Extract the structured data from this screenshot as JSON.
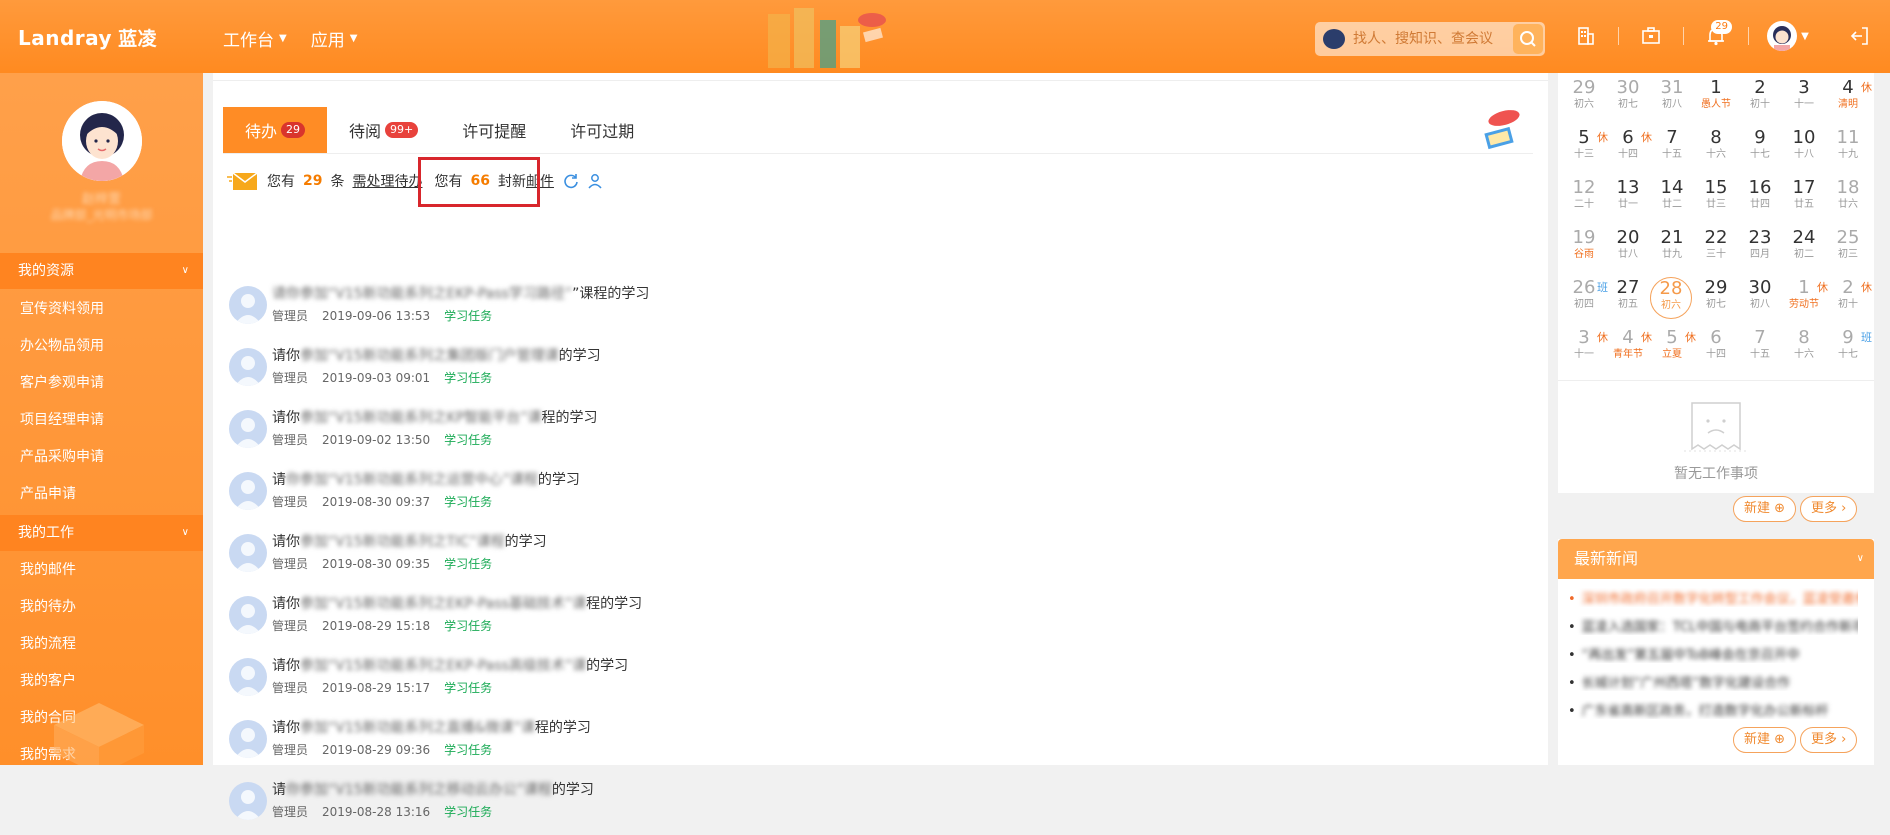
{
  "header": {
    "logo_en": "Landray",
    "logo_cn": "蓝凌",
    "nav": [
      {
        "label": "工作台"
      },
      {
        "label": "应用"
      }
    ],
    "search_placeholder": "找人、搜知识、查会议",
    "notification_count": "29",
    "colors": {
      "brand": "#ff8a20",
      "accent": "#f57c00"
    }
  },
  "sidebar": {
    "user_name": "赵梓萱",
    "user_dept": "品牌部_光明市场部",
    "sections": [
      {
        "label": "我的资源",
        "items": [
          "宣传资料领用",
          "办公物品领用",
          "客户参观申请",
          "项目经理申请",
          "产品采购申请",
          "产品申请"
        ]
      },
      {
        "label": "我的工作",
        "items": [
          "我的邮件",
          "我的待办",
          "我的流程",
          "我的客户",
          "我的合同",
          "我的需求"
        ]
      }
    ]
  },
  "main": {
    "tabs": [
      {
        "label": "待办",
        "badge": "29"
      },
      {
        "label": "待阅",
        "badge": "99+"
      },
      {
        "label": "许可提醒",
        "badge": ""
      },
      {
        "label": "许可过期",
        "badge": ""
      }
    ],
    "notice": {
      "prefix": "您有",
      "todo_count": "29",
      "unit": "条",
      "todo_link": "需处理待办",
      "mail_prefix": "您有",
      "mail_count": "66",
      "mail_unit": "封新",
      "mail_link": "邮件"
    },
    "tasks": [
      {
        "title_lead": "",
        "title_blur": "请你参加“V15新功能系列之EKP-Pass学习路径”",
        "title_tail": "”课程的学习",
        "author": "管理员",
        "time": "2019-09-06 13:53",
        "tag": "学习任务"
      },
      {
        "title_lead": "请你",
        "title_blur": "参加“V15新功能系列之集团版门户管理课",
        "title_tail": "的学习",
        "author": "管理员",
        "time": "2019-09-03 09:01",
        "tag": "学习任务"
      },
      {
        "title_lead": "请你",
        "title_blur": "参加“V15新功能系列之KP智能平台”课",
        "title_tail": "程的学习",
        "author": "管理员",
        "time": "2019-09-02 13:50",
        "tag": "学习任务"
      },
      {
        "title_lead": "请",
        "title_blur": "你参加“V15新功能系列之运营中心”课程",
        "title_tail": "的学习",
        "author": "管理员",
        "time": "2019-08-30 09:37",
        "tag": "学习任务"
      },
      {
        "title_lead": "请你",
        "title_blur": "参加“V15新功能系列之TIC”课程",
        "title_tail": "的学习",
        "author": "管理员",
        "time": "2019-08-30 09:35",
        "tag": "学习任务"
      },
      {
        "title_lead": "请你",
        "title_blur": "参加“V15新功能系列之EKP-Pass基础技术”课",
        "title_tail": "程的学习",
        "author": "管理员",
        "time": "2019-08-29 15:18",
        "tag": "学习任务"
      },
      {
        "title_lead": "请你",
        "title_blur": "参加“V15新功能系列之EKP-Pass高级技术”课",
        "title_tail": "的学习",
        "author": "管理员",
        "time": "2019-08-29 15:17",
        "tag": "学习任务"
      },
      {
        "title_lead": "请你",
        "title_blur": "参加“V15新功能系列之直播&微课”课",
        "title_tail": "程的学习",
        "author": "管理员",
        "time": "2019-08-29 09:36",
        "tag": "学习任务"
      },
      {
        "title_lead": "请",
        "title_blur": "你参加“V15新功能系列之移动云办公”课程",
        "title_tail": "的学习",
        "author": "管理员",
        "time": "2019-08-28 13:16",
        "tag": "学习任务"
      }
    ]
  },
  "calendar": {
    "rows": [
      [
        {
          "d": "29",
          "l": "初六",
          "m": 1
        },
        {
          "d": "30",
          "l": "初七",
          "m": 1
        },
        {
          "d": "31",
          "l": "初八",
          "m": 1
        },
        {
          "d": "1",
          "l": "愚人节",
          "h": 1
        },
        {
          "d": "2",
          "l": "初十"
        },
        {
          "d": "3",
          "l": "十一"
        },
        {
          "d": "4",
          "l": "清明",
          "h": 1,
          "t": "休"
        }
      ],
      [
        {
          "d": "5",
          "l": "十三",
          "t": "休"
        },
        {
          "d": "6",
          "l": "十四",
          "t": "休"
        },
        {
          "d": "7",
          "l": "十五"
        },
        {
          "d": "8",
          "l": "十六"
        },
        {
          "d": "9",
          "l": "十七"
        },
        {
          "d": "10",
          "l": "十八"
        },
        {
          "d": "11",
          "l": "十九",
          "m": 1
        }
      ],
      [
        {
          "d": "12",
          "l": "二十",
          "m": 1
        },
        {
          "d": "13",
          "l": "廿一"
        },
        {
          "d": "14",
          "l": "廿二"
        },
        {
          "d": "15",
          "l": "廿三"
        },
        {
          "d": "16",
          "l": "廿四"
        },
        {
          "d": "17",
          "l": "廿五"
        },
        {
          "d": "18",
          "l": "廿六",
          "m": 1
        }
      ],
      [
        {
          "d": "19",
          "l": "谷雨",
          "h": 1,
          "m": 1
        },
        {
          "d": "20",
          "l": "廿八"
        },
        {
          "d": "21",
          "l": "廿九"
        },
        {
          "d": "22",
          "l": "三十"
        },
        {
          "d": "23",
          "l": "四月"
        },
        {
          "d": "24",
          "l": "初二"
        },
        {
          "d": "25",
          "l": "初三",
          "m": 1
        }
      ],
      [
        {
          "d": "26",
          "l": "初四",
          "t": "班",
          "b": 1,
          "m": 1
        },
        {
          "d": "27",
          "l": "初五"
        },
        {
          "d": "28",
          "l": "初六",
          "today": 1
        },
        {
          "d": "29",
          "l": "初七"
        },
        {
          "d": "30",
          "l": "初八"
        },
        {
          "d": "1",
          "l": "劳动节",
          "h": 1,
          "t": "休",
          "m": 1
        },
        {
          "d": "2",
          "l": "初十",
          "t": "休",
          "m": 1
        }
      ],
      [
        {
          "d": "3",
          "l": "十一",
          "t": "休",
          "m": 1
        },
        {
          "d": "4",
          "l": "青年节",
          "h": 1,
          "t": "休",
          "m": 1
        },
        {
          "d": "5",
          "l": "立夏",
          "h": 1,
          "t": "休",
          "m": 1
        },
        {
          "d": "6",
          "l": "十四",
          "m": 1
        },
        {
          "d": "7",
          "l": "十五",
          "m": 1
        },
        {
          "d": "8",
          "l": "十六",
          "m": 1
        },
        {
          "d": "9",
          "l": "十七",
          "t": "班",
          "b": 1,
          "m": 1
        }
      ]
    ],
    "empty_text": "暂无工作事项",
    "new_label": "新建",
    "more_label": "更多"
  },
  "news": {
    "title": "最新新闻",
    "items": [
      "深圳市政府召开数字化转型工作会议，蓝凌受邀参会",
      "蓝凌入选国家：TCL中国与电商平台签约合作新项目",
      "“再出发”第五届中ToB峰会在京召开中",
      "长城计划“广州西塔”数字化建设合作",
      "广东省高新区政务，打造数字化办公新标杆"
    ],
    "new_label": "新建",
    "more_label": "更多"
  }
}
